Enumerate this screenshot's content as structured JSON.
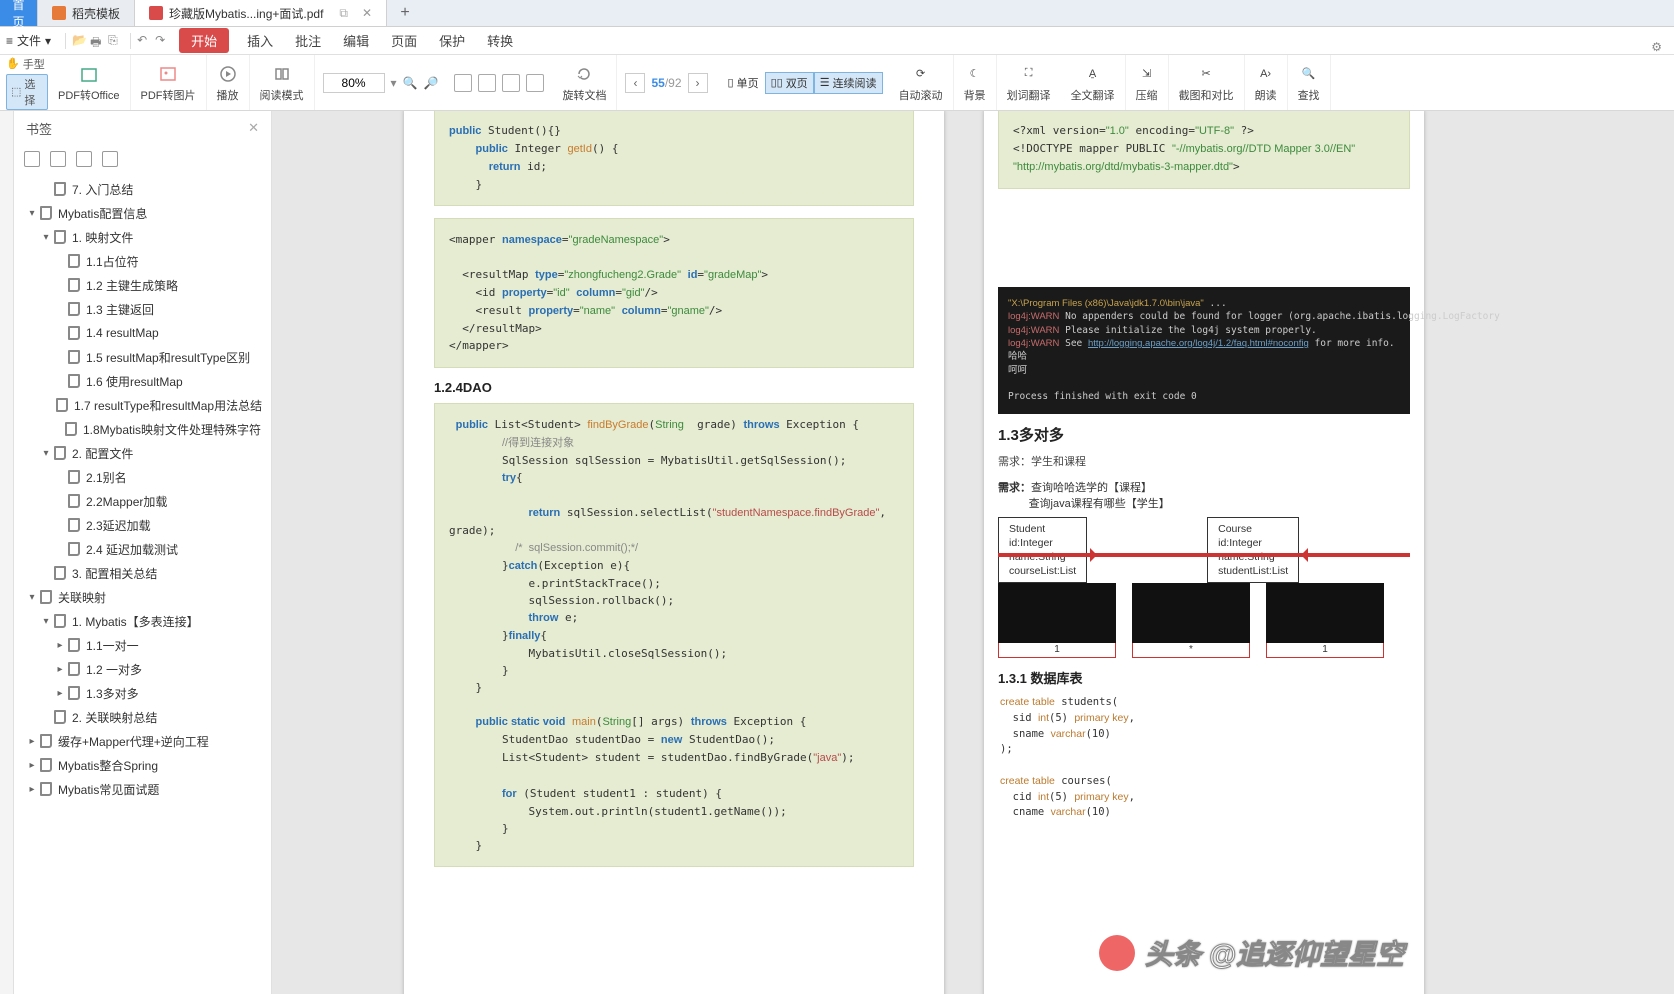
{
  "tabs": {
    "home": "首页",
    "wps": "稻壳模板",
    "pdf": "珍藏版Mybatis...ing+面试.pdf"
  },
  "menu": {
    "file": "文件",
    "items": [
      "开始",
      "插入",
      "批注",
      "编辑",
      "页面",
      "保护",
      "转换"
    ]
  },
  "toolbar": {
    "hand": "手型",
    "select": "选择",
    "pdf_office": "PDF转Office",
    "pdf_img": "PDF转图片",
    "play": "播放",
    "read": "阅读模式",
    "zoom": "80%",
    "rotate": "旋转文档",
    "page_cur": "55",
    "page_total": "/92",
    "single": "单页",
    "double": "双页",
    "cont": "连续阅读",
    "autoscroll": "自动滚动",
    "bg": "背景",
    "sel_trans": "划词翻译",
    "full_trans": "全文翻译",
    "compress": "压缩",
    "shot": "截图和对比",
    "read_aloud": "朗读",
    "find": "查找"
  },
  "sidebar": {
    "title": "书签",
    "nodes": [
      {
        "d": 1,
        "c": "",
        "t": "7. 入门总结"
      },
      {
        "d": 0,
        "c": "▾",
        "t": "Mybatis配置信息"
      },
      {
        "d": 1,
        "c": "▾",
        "t": "1. 映射文件"
      },
      {
        "d": 2,
        "c": "",
        "t": "1.1占位符"
      },
      {
        "d": 2,
        "c": "",
        "t": "1.2 主键生成策略"
      },
      {
        "d": 2,
        "c": "",
        "t": "1.3 主键返回"
      },
      {
        "d": 2,
        "c": "",
        "t": "1.4 resultMap"
      },
      {
        "d": 2,
        "c": "",
        "t": "1.5 resultMap和resultType区别"
      },
      {
        "d": 2,
        "c": "",
        "t": "1.6 使用resultMap"
      },
      {
        "d": 2,
        "c": "",
        "t": "1.7 resultType和resultMap用法总结"
      },
      {
        "d": 2,
        "c": "",
        "t": "1.8Mybatis映射文件处理特殊字符"
      },
      {
        "d": 1,
        "c": "▾",
        "t": "2. 配置文件"
      },
      {
        "d": 2,
        "c": "",
        "t": "2.1别名"
      },
      {
        "d": 2,
        "c": "",
        "t": "2.2Mapper加载"
      },
      {
        "d": 2,
        "c": "",
        "t": "2.3延迟加载"
      },
      {
        "d": 2,
        "c": "",
        "t": "2.4 延迟加载测试"
      },
      {
        "d": 1,
        "c": "",
        "t": "3. 配置相关总结"
      },
      {
        "d": 0,
        "c": "▾",
        "t": "关联映射"
      },
      {
        "d": 1,
        "c": "▾",
        "t": "1. Mybatis【多表连接】"
      },
      {
        "d": 2,
        "c": "▸",
        "t": "1.1一对一"
      },
      {
        "d": 2,
        "c": "▸",
        "t": "1.2 一对多"
      },
      {
        "d": 2,
        "c": "▸",
        "t": "1.3多对多"
      },
      {
        "d": 1,
        "c": "",
        "t": "2. 关联映射总结"
      },
      {
        "d": 0,
        "c": "▸",
        "t": "缓存+Mapper代理+逆向工程"
      },
      {
        "d": 0,
        "c": "▸",
        "t": "Mybatis整合Spring"
      },
      {
        "d": 0,
        "c": "▸",
        "t": "Mybatis常见面试题"
      }
    ]
  },
  "doc": {
    "left_top": "    public Student(){}\n    public Integer getId() {\n      return id;\n    }",
    "xml": "<mapper namespace=\"gradeNamespace\">\n\n  <resultMap type=\"zhongfucheng2.Grade\" id=\"gradeMap\">\n    <id property=\"id\" column=\"gid\"/>\n    <result property=\"name\" column=\"gname\"/>\n  </resultMap>\n</mapper>",
    "h_dao": "1.2.4DAO",
    "dao": " public List<Student> findByGrade(String  grade) throws Exception {\n        //得到连接对象\n        SqlSession sqlSession = MybatisUtil.getSqlSession();\n        try{\n\n            return sqlSession.selectList(\"studentNamespace.findByGrade\",\ngrade);\n          /*  sqlSession.commit();*/\n        }catch(Exception e){\n            e.printStackTrace();\n            sqlSession.rollback();\n            throw e;\n        }finally{\n            MybatisUtil.closeSqlSession();\n        }\n    }\n\n    public static void main(String[] args) throws Exception {\n        StudentDao studentDao = new StudentDao();\n        List<Student> student = studentDao.findByGrade(\"java\");\n\n        for (Student student1 : student) {\n            System.out.println(student1.getName());\n        }\n    }",
    "xml_top": "<?xml version=\"1.0\" encoding=\"UTF-8\" ?>\n<!DOCTYPE mapper PUBLIC \"-//mybatis.org//DTD Mapper 3.0//EN\"\n\"http://mybatis.org/dtd/mybatis-3-mapper.dtd\">",
    "h_133": "1.3多对多",
    "req": "需求：学生和课程",
    "dreq1": "查询哈哈选学的【课程】",
    "dreq2": "查询java课程有哪些【学生】",
    "box1": "Student\nid:Integer\nname:String\ncourseList:List",
    "box2": "Course\nid:Integer\nname:String\nstudentList:List",
    "mt": [
      "1",
      "*",
      "1"
    ],
    "h_131": "1.3.1 数据库表",
    "sql": "create table students(\n  sid int(5) primary key,\n  sname varchar(10)\n);\n\ncreate table courses(\n  cid int(5) primary key,\n  cname varchar(10)",
    "term": "\"X:\\Program Files (x86)\\Java\\jdk1.7.0\\bin\\java\" ...\nlog4j:WARN No appenders could be found for logger (org.apache.ibatis.logging.LogFactory\nlog4j:WARN Please initialize the log4j system properly.\nlog4j:WARN See http://logging.apache.org/log4j/1.2/faq.html#noconfig for more info.\n哈哈\n呵呵\n\nProcess finished with exit code 0",
    "wm": "头条 @追逐仰望星空",
    "dreq_label": "需求："
  }
}
